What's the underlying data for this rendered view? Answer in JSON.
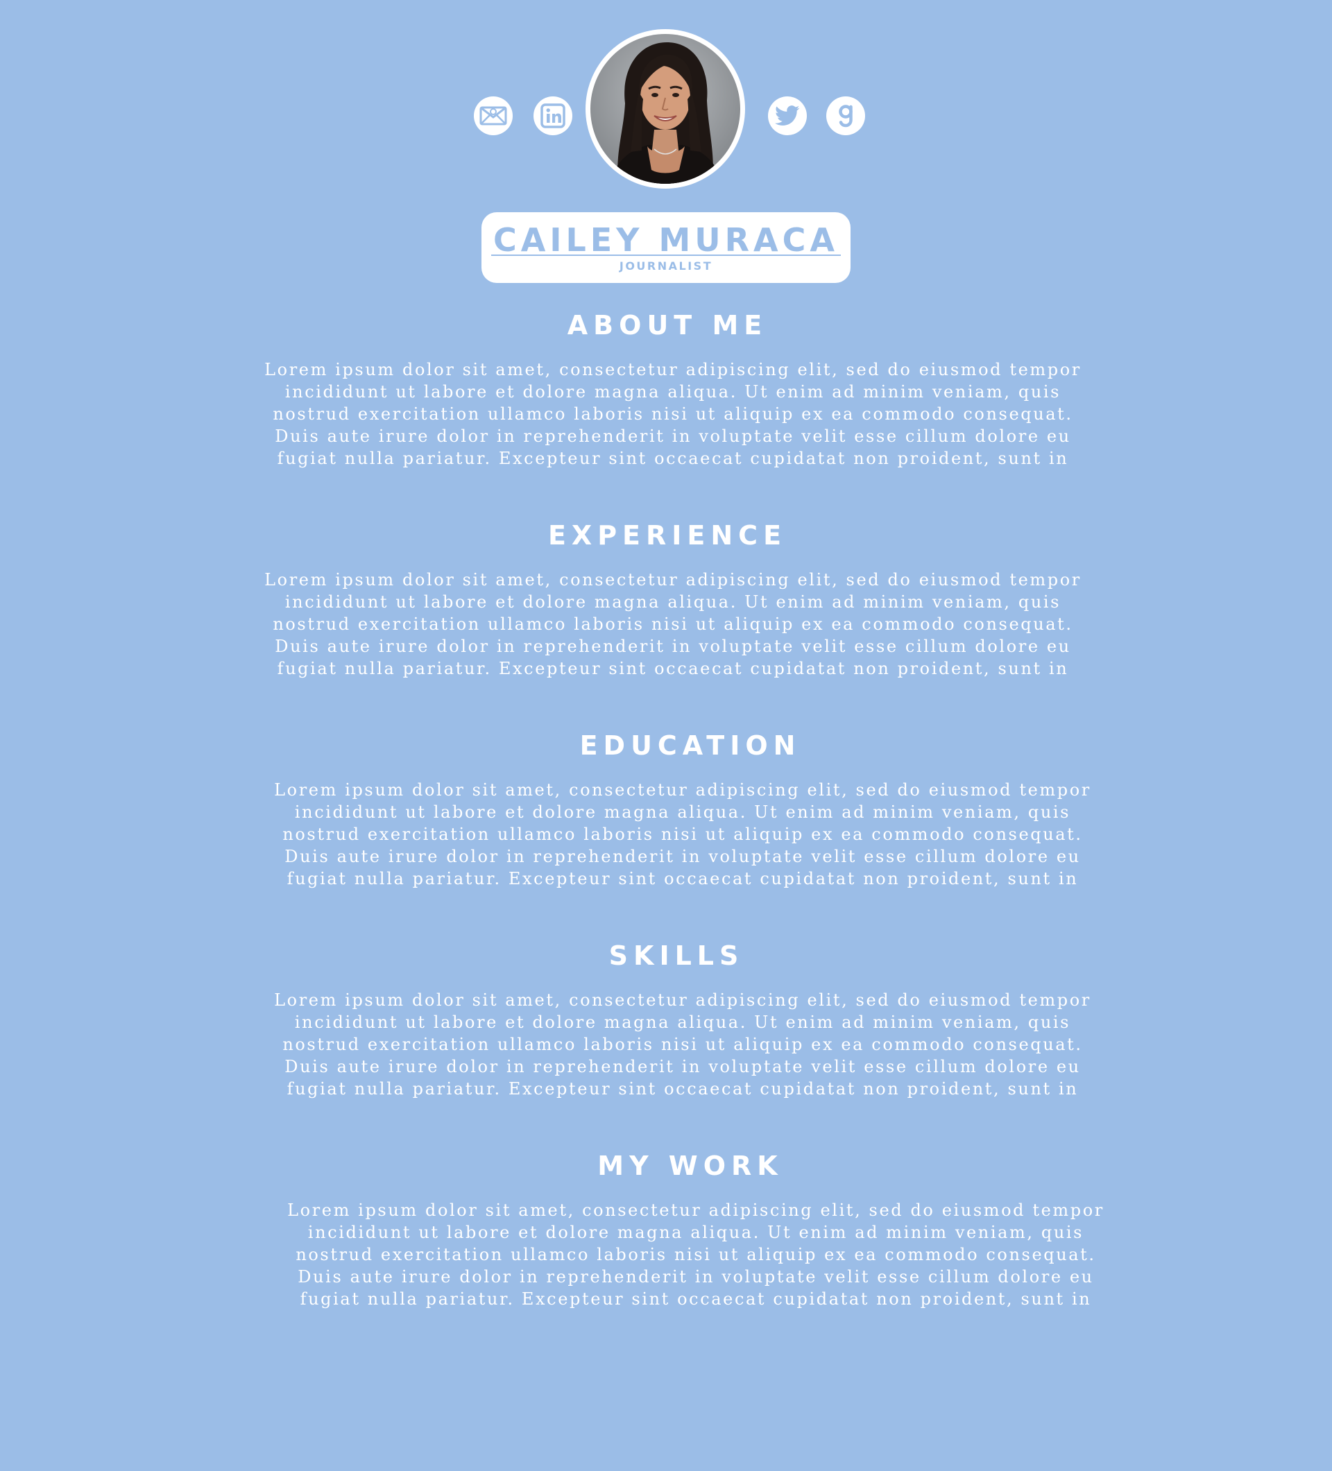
{
  "profile": {
    "name": "CAILEY MURACA",
    "title": "JOURNALIST"
  },
  "social": [
    {
      "icon": "email-icon"
    },
    {
      "icon": "linkedin-icon"
    },
    {
      "icon": "twitter-icon"
    },
    {
      "icon": "goodreads-icon"
    }
  ],
  "sections": {
    "about": {
      "heading": "ABOUT ME",
      "body": "Lorem ipsum dolor sit amet, consectetur adipiscing elit, sed do eiusmod tempor\nincididunt ut labore et dolore magna aliqua. Ut enim ad minim veniam, quis\nnostrud exercitation ullamco laboris nisi ut aliquip ex ea commodo consequat.\nDuis aute irure dolor in reprehenderit in voluptate velit esse cillum dolore eu\nfugiat nulla pariatur. Excepteur sint occaecat cupidatat non proident, sunt in"
    },
    "experience": {
      "heading": "EXPERIENCE",
      "body": "Lorem ipsum dolor sit amet, consectetur adipiscing elit, sed do eiusmod tempor\nincididunt ut labore et dolore magna aliqua. Ut enim ad minim veniam, quis\nnostrud exercitation ullamco laboris nisi ut aliquip ex ea commodo consequat.\nDuis aute irure dolor in reprehenderit in voluptate velit esse cillum dolore eu\nfugiat nulla pariatur. Excepteur sint occaecat cupidatat non proident, sunt in"
    },
    "education": {
      "heading": "EDUCATION",
      "body": "Lorem ipsum dolor sit amet, consectetur adipiscing elit, sed do eiusmod tempor\nincididunt ut labore et dolore magna aliqua. Ut enim ad minim veniam, quis\nnostrud exercitation ullamco laboris nisi ut aliquip ex ea commodo consequat.\nDuis aute irure dolor in reprehenderit in voluptate velit esse cillum dolore eu\nfugiat nulla pariatur. Excepteur sint occaecat cupidatat non proident, sunt in"
    },
    "skills": {
      "heading": "SKILLS",
      "body": "Lorem ipsum dolor sit amet, consectetur adipiscing elit, sed do eiusmod tempor\nincididunt ut labore et dolore magna aliqua. Ut enim ad minim veniam, quis\nnostrud exercitation ullamco laboris nisi ut aliquip ex ea commodo consequat.\nDuis aute irure dolor in reprehenderit in voluptate velit esse cillum dolore eu\nfugiat nulla pariatur. Excepteur sint occaecat cupidatat non proident, sunt in"
    },
    "work": {
      "heading": "MY WORK",
      "body": "Lorem ipsum dolor sit amet, consectetur adipiscing elit, sed do eiusmod tempor\nincididunt ut labore et dolore magna aliqua. Ut enim ad minim veniam, quis\nnostrud exercitation ullamco laboris nisi ut aliquip ex ea commodo consequat.\nDuis aute irure dolor in reprehenderit in voluptate velit esse cillum dolore eu\nfugiat nulla pariatur. Excepteur sint occaecat cupidatat non proident, sunt in"
    }
  },
  "colors": {
    "background": "#9bbde7",
    "card": "#ffffff",
    "text": "#ffffff",
    "accent": "#9bbde7"
  }
}
